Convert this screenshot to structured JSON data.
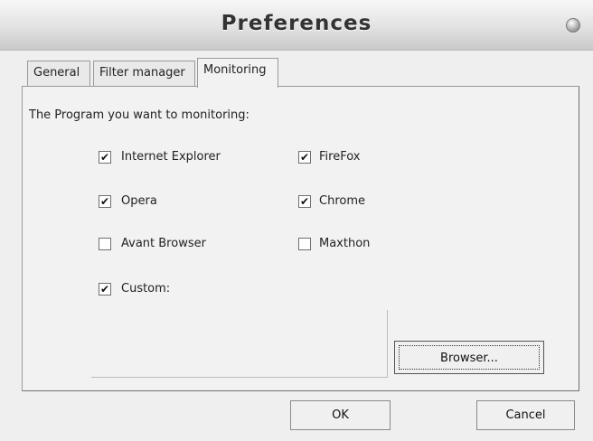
{
  "window": {
    "title": "Preferences"
  },
  "tabs": [
    {
      "label": "General"
    },
    {
      "label": "Filter manager"
    },
    {
      "label": "Monitoring",
      "active": true
    }
  ],
  "monitoring": {
    "prompt": "The Program you want to monitoring:",
    "browsers": [
      {
        "label": "Internet Explorer",
        "checked": true
      },
      {
        "label": "FireFox",
        "checked": true
      },
      {
        "label": "Opera",
        "checked": true
      },
      {
        "label": "Chrome",
        "checked": true
      },
      {
        "label": "Avant Browser",
        "checked": false
      },
      {
        "label": "Maxthon",
        "checked": false
      },
      {
        "label": "Custom:",
        "checked": true
      }
    ],
    "browse_button": "Browser..."
  },
  "footer": {
    "ok_label": "OK",
    "cancel_label": "Cancel"
  },
  "icons": {
    "close": "close-orb-icon",
    "checkmark": "checkmark-icon"
  }
}
